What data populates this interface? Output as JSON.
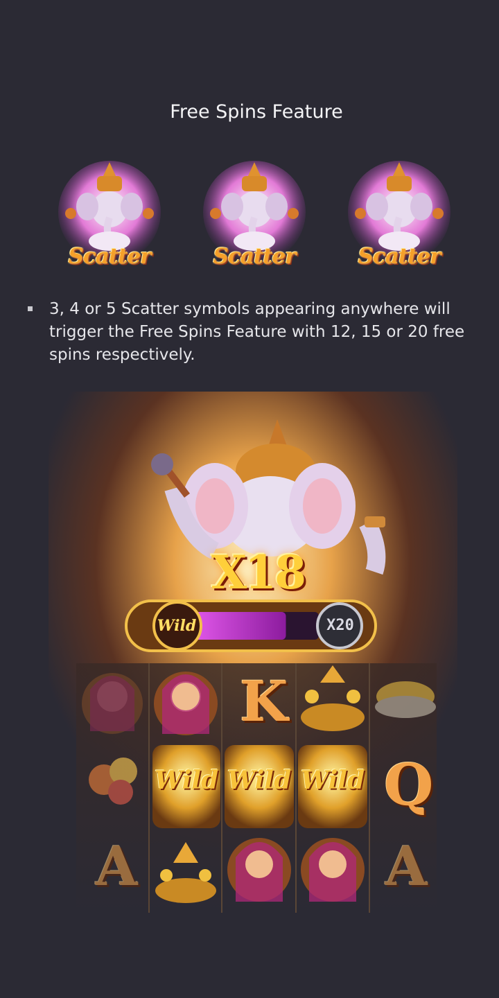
{
  "section": {
    "title": "Free Spins Feature"
  },
  "scatters": [
    {
      "label": "Scatter",
      "icon": "ganesha-scatter-icon"
    },
    {
      "label": "Scatter",
      "icon": "ganesha-scatter-icon"
    },
    {
      "label": "Scatter",
      "icon": "ganesha-scatter-icon"
    }
  ],
  "rules": [
    "3, 4 or 5 Scatter symbols appearing anywhere will trigger the Free Spins Feature with 12, 15 or 20 free spins respectively."
  ],
  "game": {
    "multiplier": "X18",
    "bar_wild_label": "Wild",
    "bar_max_label": "X20",
    "bar_progress": 0.75,
    "reels": {
      "row1": [
        "woman",
        "woman",
        "K",
        "diya",
        "bowl"
      ],
      "row2": [
        "flowers",
        "Wild",
        "Wild",
        "Wild",
        "Q"
      ],
      "row3": [
        "A",
        "diya",
        "woman",
        "woman",
        "A"
      ]
    },
    "letters": {
      "k": "K",
      "q": "Q",
      "a1": "A",
      "a2": "A"
    },
    "wild_label": "Wild",
    "colors": {
      "accent_gold": "#f5b635",
      "bar_fill": "#c93bd6",
      "background": "#2b2a34"
    }
  }
}
